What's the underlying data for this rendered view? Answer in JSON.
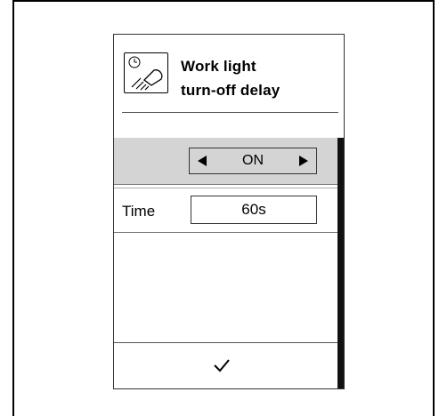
{
  "header": {
    "icon": "work-light-timer-icon",
    "title_line1": "Work light",
    "title_line2": "turn-off delay"
  },
  "mode_selector": {
    "value": "ON",
    "left_icon": "left-triangle-arrow",
    "right_icon": "right-triangle-arrow"
  },
  "time": {
    "label": "Time",
    "value": "60s"
  },
  "footer": {
    "confirm_icon": "checkmark-icon"
  }
}
